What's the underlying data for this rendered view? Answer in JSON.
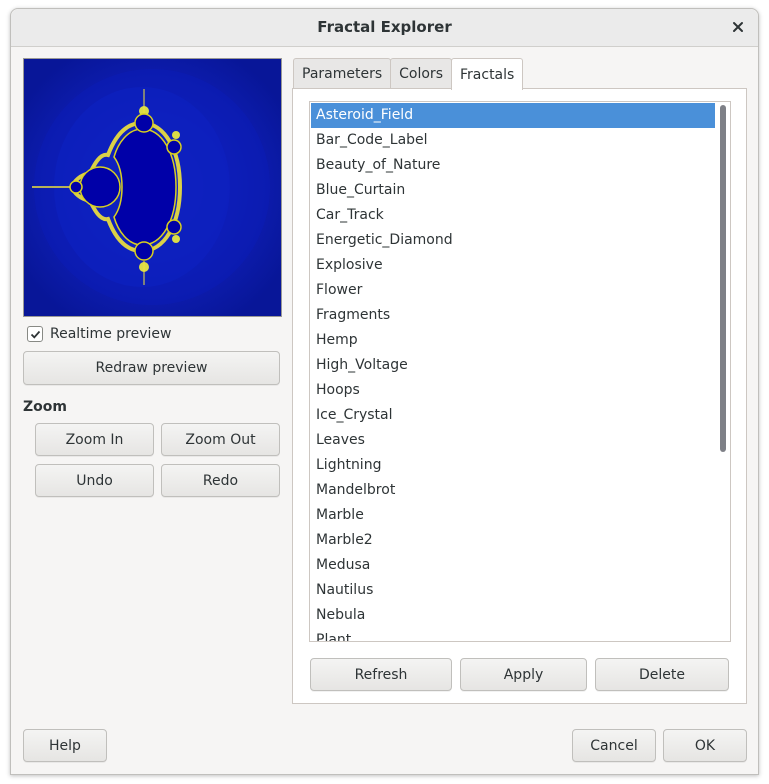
{
  "window": {
    "title": "Fractal Explorer"
  },
  "preview": {
    "realtime_label": "Realtime preview",
    "realtime_checked": true,
    "redraw_label": "Redraw preview"
  },
  "zoom": {
    "label": "Zoom",
    "zoom_in": "Zoom In",
    "zoom_out": "Zoom Out",
    "undo": "Undo",
    "redo": "Redo"
  },
  "tabs": [
    {
      "label": "Parameters",
      "active": false
    },
    {
      "label": "Colors",
      "active": false
    },
    {
      "label": "Fractals",
      "active": true
    }
  ],
  "fractals": {
    "selected": "Asteroid_Field",
    "items": [
      "Asteroid_Field",
      "Bar_Code_Label",
      "Beauty_of_Nature",
      "Blue_Curtain",
      "Car_Track",
      "Energetic_Diamond",
      "Explosive",
      "Flower",
      "Fragments",
      "Hemp",
      "High_Voltage",
      "Hoops",
      "Ice_Crystal",
      "Leaves",
      "Lightning",
      "Mandelbrot",
      "Marble",
      "Marble2",
      "Medusa",
      "Nautilus",
      "Nebula",
      "Plant"
    ],
    "refresh": "Refresh",
    "apply": "Apply",
    "delete": "Delete"
  },
  "footer": {
    "help": "Help",
    "cancel": "Cancel",
    "ok": "OK"
  },
  "colors": {
    "selection": "#4a90d9",
    "fractal_bg": "#0a1a9c",
    "fractal_set": "#0000a8",
    "fractal_edge": "#ffff33"
  }
}
